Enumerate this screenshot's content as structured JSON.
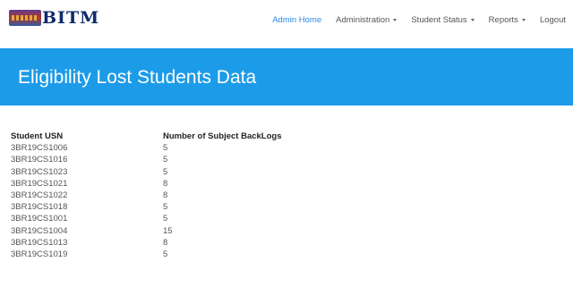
{
  "brand": {
    "name": "BITM"
  },
  "nav": {
    "items": [
      {
        "label": "Admin Home",
        "active": true,
        "dropdown": false
      },
      {
        "label": "Administration",
        "active": false,
        "dropdown": true
      },
      {
        "label": "Student Status",
        "active": false,
        "dropdown": true
      },
      {
        "label": "Reports",
        "active": false,
        "dropdown": true
      },
      {
        "label": "Logout",
        "active": false,
        "dropdown": false
      }
    ]
  },
  "page": {
    "title": "Eligibility Lost Students Data"
  },
  "table": {
    "headers": [
      "Student USN",
      "Number of Subject BackLogs"
    ],
    "rows": [
      [
        "3BR19CS1006",
        "5"
      ],
      [
        "3BR19CS1016",
        "5"
      ],
      [
        "3BR19CS1023",
        "5"
      ],
      [
        "3BR19CS1021",
        "8"
      ],
      [
        "3BR19CS1022",
        "8"
      ],
      [
        "3BR19CS1018",
        "5"
      ],
      [
        "3BR19CS1001",
        "5"
      ],
      [
        "3BR19CS1004",
        "15"
      ],
      [
        "3BR19CS1013",
        "8"
      ],
      [
        "3BR19CS1019",
        "5"
      ]
    ]
  },
  "colors": {
    "accent": "#1c9be8",
    "nav_active": "#2a8be8",
    "brand_text": "#0f2a6b"
  }
}
